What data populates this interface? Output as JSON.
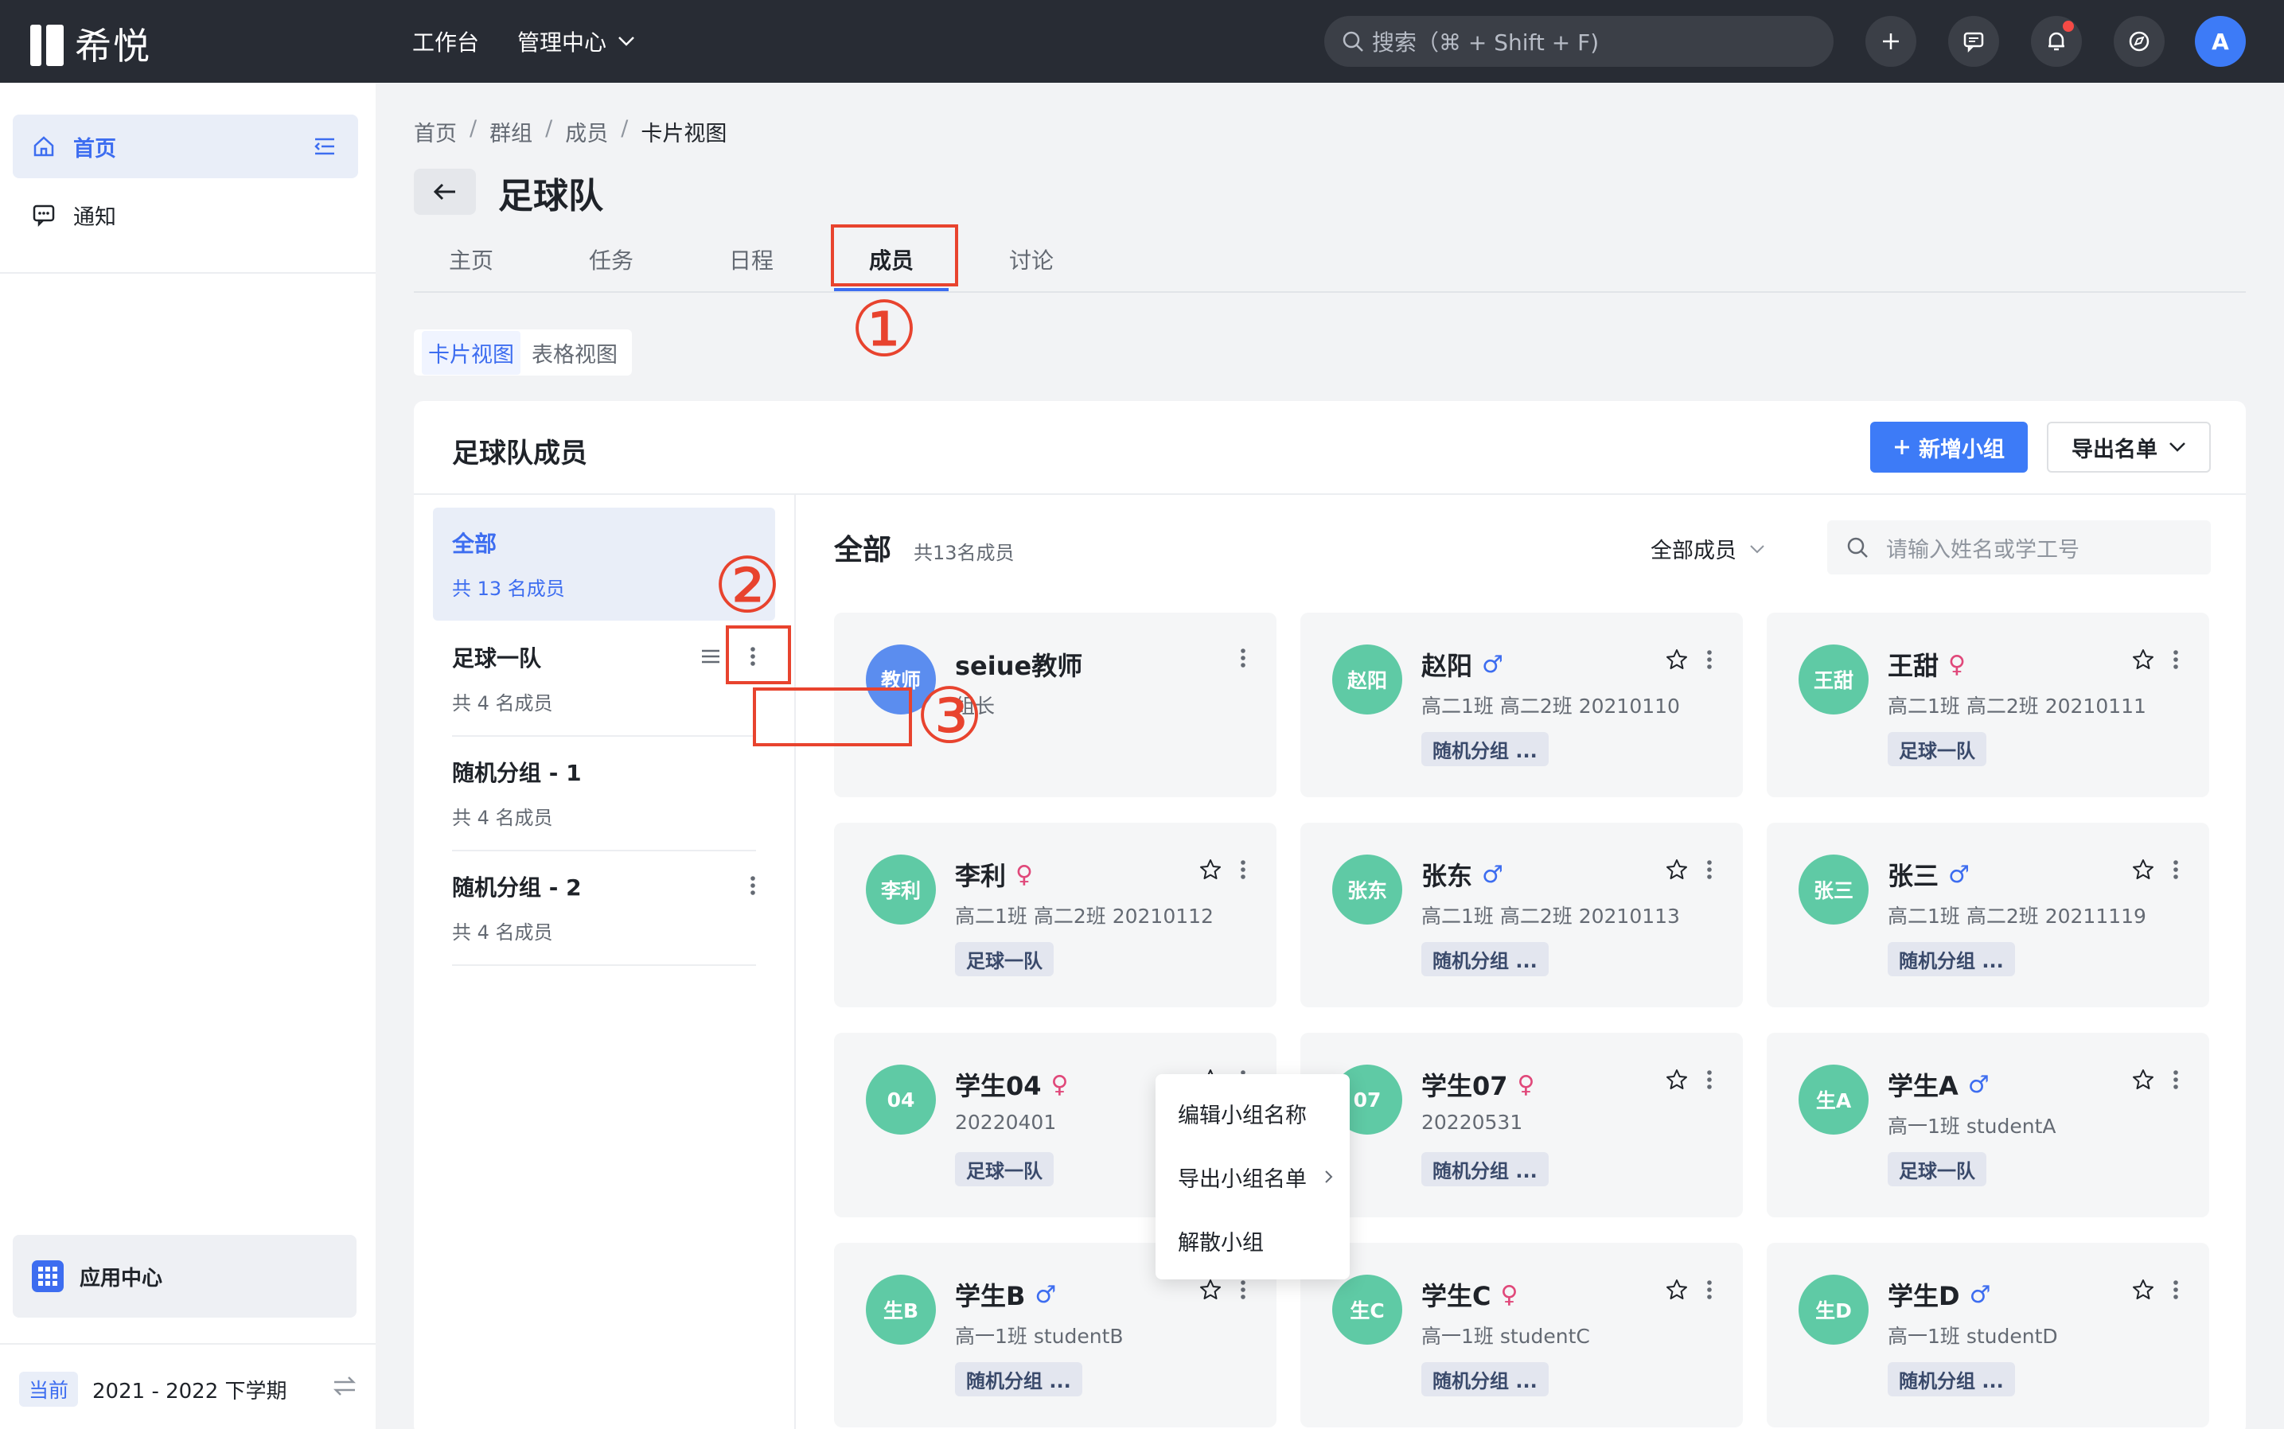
{
  "app": {
    "name": "希悦"
  },
  "topnav": {
    "workbench": "工作台",
    "management": "管理中心",
    "search_placeholder": "搜索（⌘ + Shift + F)",
    "avatar_letter": "A"
  },
  "sidebar": {
    "home": "首页",
    "notice": "通知",
    "app_center": "应用中心",
    "term_badge": "当前",
    "term": "2021 - 2022 下学期"
  },
  "breadcrumb": [
    "首页",
    "群组",
    "成员",
    "卡片视图"
  ],
  "page": {
    "title": "足球队",
    "tabs": [
      "主页",
      "任务",
      "日程",
      "成员",
      "讨论"
    ],
    "active_tab": "成员",
    "views": [
      "卡片视图",
      "表格视图"
    ]
  },
  "annotations": [
    "①",
    "②",
    "③"
  ],
  "panel": {
    "title": "足球队成员",
    "new_group": "新增小组",
    "export": "导出名单",
    "groups": [
      {
        "name": "全部",
        "count": "共 13 名成员"
      },
      {
        "name": "足球一队",
        "count": "共 4 名成员"
      },
      {
        "name": "随机分组 - 1",
        "count": "共 4 名成员"
      },
      {
        "name": "随机分组 - 2",
        "count": "共 4 名成员"
      }
    ],
    "menu": [
      "编辑小组名称",
      "导出小组名单",
      "解散小组"
    ],
    "content_title": "全部",
    "content_count": "共13名成员",
    "filter": "全部成员",
    "search_placeholder": "请输入姓名或学工号"
  },
  "members": [
    {
      "avatar": "教师",
      "name": "seiue教师",
      "gender": "",
      "sub": "组长",
      "tag": "",
      "color": "#5b8def"
    },
    {
      "avatar": "赵阳",
      "name": "赵阳",
      "gender": "♂",
      "sub": "高二1班 高二2班 20210110",
      "tag": "随机分组 ...",
      "color": "#5fcaa5"
    },
    {
      "avatar": "王甜",
      "name": "王甜",
      "gender": "♀",
      "sub": "高二1班 高二2班 20210111",
      "tag": "足球一队",
      "color": "#5fcaa5"
    },
    {
      "avatar": "李利",
      "name": "李利",
      "gender": "♀",
      "sub": "高二1班 高二2班 20210112",
      "tag": "足球一队",
      "color": "#5fcaa5"
    },
    {
      "avatar": "张东",
      "name": "张东",
      "gender": "♂",
      "sub": "高二1班 高二2班 20210113",
      "tag": "随机分组 ...",
      "color": "#5fcaa5"
    },
    {
      "avatar": "张三",
      "name": "张三",
      "gender": "♂",
      "sub": "高二1班 高二2班 20211119",
      "tag": "随机分组 ...",
      "color": "#5fcaa5"
    },
    {
      "avatar": "04",
      "name": "学生04",
      "gender": "♀",
      "sub": "20220401",
      "tag": "足球一队",
      "color": "#5fcaa5"
    },
    {
      "avatar": "07",
      "name": "学生07",
      "gender": "♀",
      "sub": "20220531",
      "tag": "随机分组 ...",
      "color": "#5fcaa5"
    },
    {
      "avatar": "生A",
      "name": "学生A",
      "gender": "♂",
      "sub": "高一1班 studentA",
      "tag": "足球一队",
      "color": "#5fcaa5"
    },
    {
      "avatar": "生B",
      "name": "学生B",
      "gender": "♂",
      "sub": "高一1班 studentB",
      "tag": "随机分组 ...",
      "color": "#5fcaa5"
    },
    {
      "avatar": "生C",
      "name": "学生C",
      "gender": "♀",
      "sub": "高一1班 studentC",
      "tag": "随机分组 ...",
      "color": "#5fcaa5"
    },
    {
      "avatar": "生D",
      "name": "学生D",
      "gender": "♂",
      "sub": "高一1班 studentD",
      "tag": "随机分组 ...",
      "color": "#5fcaa5"
    }
  ]
}
